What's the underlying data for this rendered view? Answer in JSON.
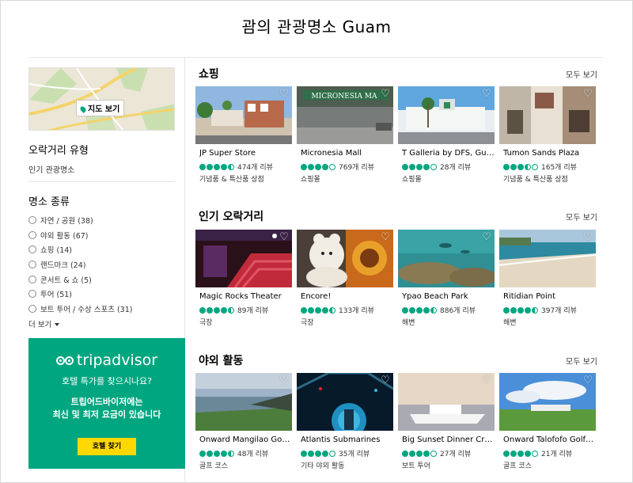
{
  "page_title": "괌의 관광명소 Guam",
  "sidebar": {
    "map_button": "지도 보기",
    "filter1_title": "오락거리 유형",
    "filter1_value": "인기 관광명소",
    "filter2_title": "명소 종류",
    "categories": [
      {
        "label": "자연 / 공원 (38)"
      },
      {
        "label": "야외 활동 (67)"
      },
      {
        "label": "쇼핑 (14)"
      },
      {
        "label": "랜드마크 (24)"
      },
      {
        "label": "콘서트 & 쇼 (5)"
      },
      {
        "label": "투어 (51)"
      },
      {
        "label": "보트 투어 / 수상 스포츠 (31)"
      }
    ],
    "more_label": "더 보기"
  },
  "ad": {
    "logo_text": "tripadvisor",
    "question": "호텔 특가를 찾으시나요?",
    "line1": "트립어드바이저에는",
    "line2": "최신 및 최저 요금이 있습니다",
    "button": "호텔 찾기",
    "brand_color": "#00a680",
    "button_color": "#ffd800"
  },
  "sections": [
    {
      "title": "쇼핑",
      "see_all": "모두 보기",
      "cards": [
        {
          "name": "JP Super Store",
          "rating": 4.5,
          "reviews": "474개 리뷰",
          "type": "기념품 & 특산품 상점"
        },
        {
          "name": "Micronesia Mall",
          "rating": 4,
          "reviews": "769개 리뷰",
          "type": "쇼핑몰"
        },
        {
          "name": "T Galleria by DFS, Gu…",
          "rating": 4,
          "reviews": "28개 리뷰",
          "type": "쇼핑몰"
        },
        {
          "name": "Tumon Sands Plaza",
          "rating": 3.5,
          "reviews": "165개 리뷰",
          "type": "기념품 & 특산품 상점"
        }
      ]
    },
    {
      "title": "인기 오락거리",
      "see_all": "모두 보기",
      "cards": [
        {
          "name": "Magic Rocks Theater",
          "rating": 4.5,
          "reviews": "89개 리뷰",
          "type": "극장"
        },
        {
          "name": "Encore!",
          "rating": 4.5,
          "reviews": "133개 리뷰",
          "type": "극장"
        },
        {
          "name": "Ypao Beach Park",
          "rating": 4.5,
          "reviews": "886개 리뷰",
          "type": "해변"
        },
        {
          "name": "Ritidian Point",
          "rating": 4.5,
          "reviews": "397개 리뷰",
          "type": "해변"
        }
      ]
    },
    {
      "title": "야외 활동",
      "see_all": "모두 보기",
      "cards": [
        {
          "name": "Onward Mangilao Gol…",
          "rating": 4.5,
          "reviews": "48개 리뷰",
          "type": "골프 코스"
        },
        {
          "name": "Atlantis Submarines",
          "rating": 4,
          "reviews": "35개 리뷰",
          "type": "기타 야외 활동"
        },
        {
          "name": "Big Sunset Dinner Cr…",
          "rating": 4,
          "reviews": "27개 리뷰",
          "type": "보트 투어"
        },
        {
          "name": "Onward Talofofo Golf…",
          "rating": 4,
          "reviews": "21개 리뷰",
          "type": "골프 코스"
        }
      ]
    }
  ]
}
